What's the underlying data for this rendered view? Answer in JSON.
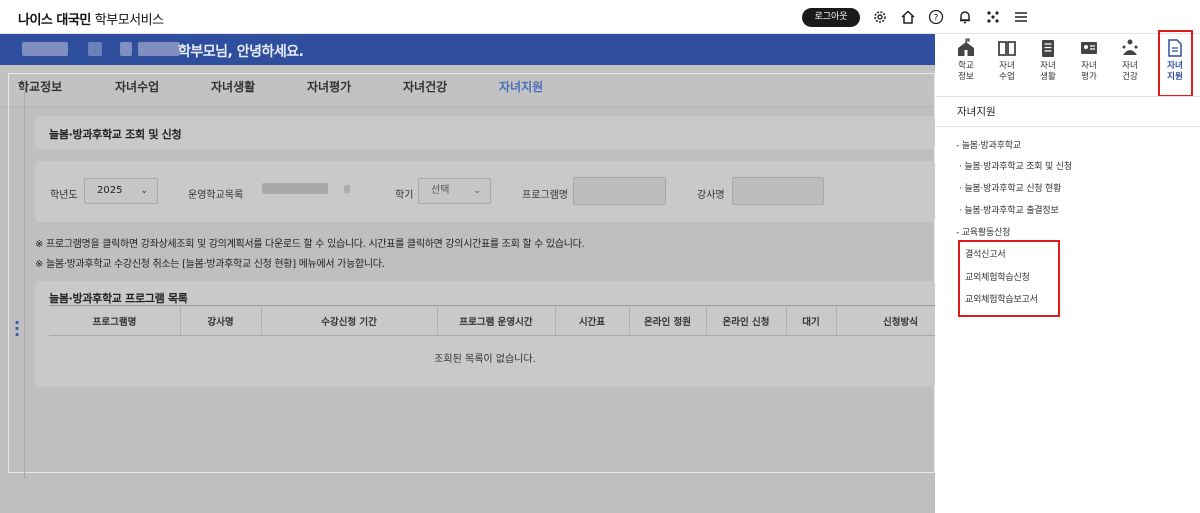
{
  "header": {
    "brand": "나이스 대국민",
    "service": "학부모서비스",
    "logout_label": "로그아웃",
    "icons": [
      "gear-icon",
      "home-icon",
      "help-icon",
      "bell-icon",
      "apps-icon",
      "menu-icon"
    ]
  },
  "main": {
    "greeting": "학부모님, 안녕하세요.",
    "nav": [
      "학교정보",
      "자녀수업",
      "자녀생활",
      "자녀평가",
      "자녀건강",
      "자녀지원"
    ],
    "page_title": "늘봄·방과후학교 조회 및 신청",
    "filters": {
      "grade_year_label": "학년도",
      "grade_year_value": "2025",
      "school_label": "운영학교목록",
      "term_label": "학기",
      "term_value": "선택",
      "program_label": "프로그램명",
      "teacher_label": "강사명"
    },
    "notices": [
      "※ 프로그램명을 클릭하면 강좌상세조회 및 강의계획서를 다운로드 할 수 있습니다. 시간표를 클릭하면 강의시간표를 조회 할 수 있습니다.",
      "※ 늘봄·방과후학교 수강신청 취소는 [늘봄·방과후학교 신청 현황] 메뉴에서 가능합니다."
    ],
    "table": {
      "title": "늘봄·방과후학교 프로그램 목록",
      "columns": [
        "프로그램명",
        "강사명",
        "수강신청 기간",
        "프로그램 운영시간",
        "시간표",
        "온라인 정원",
        "온라인 신청",
        "대기",
        "신청방식"
      ],
      "empty_message": "조회된 목록이 없습니다."
    }
  },
  "drawer": {
    "quick_menu": [
      {
        "label_top": "학교",
        "label_bottom": "정보",
        "icon": "school-icon"
      },
      {
        "label_top": "자녀",
        "label_bottom": "수업",
        "icon": "book-icon"
      },
      {
        "label_top": "자녀",
        "label_bottom": "생활",
        "icon": "checklist-icon"
      },
      {
        "label_top": "자녀",
        "label_bottom": "평가",
        "icon": "id-card-icon"
      },
      {
        "label_top": "자녀",
        "label_bottom": "건강",
        "icon": "health-icon"
      },
      {
        "label_top": "자녀",
        "label_bottom": "지원",
        "icon": "document-icon"
      }
    ],
    "section_title": "자녀지원",
    "menu": [
      "- 늘봄·방과후학교",
      "· 늘봄·방과후학교 조회 및 신청",
      "· 늘봄·방과후학교 신청 현황",
      "· 늘봄·방과후학교 출결정보",
      "- 교육활동신청",
      "결석신고서",
      "교외체험학습신청",
      "교외체험학습보고서"
    ]
  }
}
